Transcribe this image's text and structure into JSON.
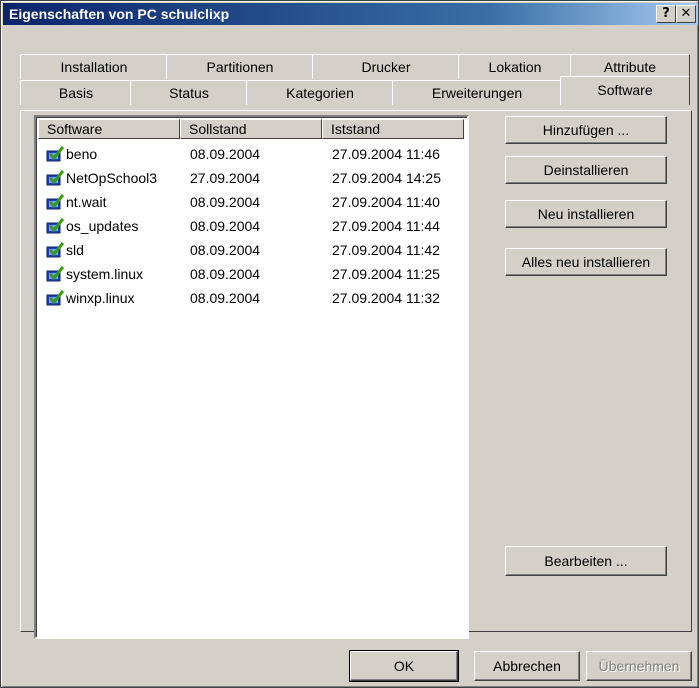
{
  "window": {
    "title": "Eigenschaften von PC schulclixp",
    "help_glyph": "?",
    "close_glyph": "✕"
  },
  "tabs_row1": [
    {
      "label": "Installation"
    },
    {
      "label": "Partitionen"
    },
    {
      "label": "Drucker"
    },
    {
      "label": "Lokation"
    },
    {
      "label": "Attribute"
    }
  ],
  "tabs_row2": [
    {
      "label": "Basis"
    },
    {
      "label": "Status"
    },
    {
      "label": "Kategorien"
    },
    {
      "label": "Erweiterungen"
    },
    {
      "label": "Software",
      "active": true
    }
  ],
  "table": {
    "columns": [
      "Software",
      "Sollstand",
      "Iststand"
    ],
    "rows": [
      {
        "name": "beno",
        "soll": "08.09.2004",
        "ist": "27.09.2004 11:46",
        "icon": "package-check-icon"
      },
      {
        "name": "NetOpSchool3",
        "soll": "27.09.2004",
        "ist": "27.09.2004 14:25",
        "icon": "package-check-icon"
      },
      {
        "name": "nt.wait",
        "soll": "08.09.2004",
        "ist": "27.09.2004 11:40",
        "icon": "package-check-icon"
      },
      {
        "name": "os_updates",
        "soll": "08.09.2004",
        "ist": "27.09.2004 11:44",
        "icon": "package-check-icon"
      },
      {
        "name": "sld",
        "soll": "08.09.2004",
        "ist": "27.09.2004 11:42",
        "icon": "package-check-icon"
      },
      {
        "name": "system.linux",
        "soll": "08.09.2004",
        "ist": "27.09.2004 11:25",
        "icon": "package-check-icon"
      },
      {
        "name": "winxp.linux",
        "soll": "08.09.2004",
        "ist": "27.09.2004 11:32",
        "icon": "package-check-icon"
      }
    ]
  },
  "actions": {
    "add": "Hinzufügen ...",
    "uninstall": "Deinstallieren",
    "reinstall": "Neu installieren",
    "reinstall_all": "Alles neu installieren",
    "edit": "Bearbeiten ..."
  },
  "footer": {
    "ok": "OK",
    "cancel": "Abbrechen",
    "apply": "Übernehmen"
  },
  "colors": {
    "face": "#d4d0c8",
    "title_start": "#0a246a",
    "icon_green": "#3a9a1a",
    "icon_blue": "#2040c0"
  }
}
